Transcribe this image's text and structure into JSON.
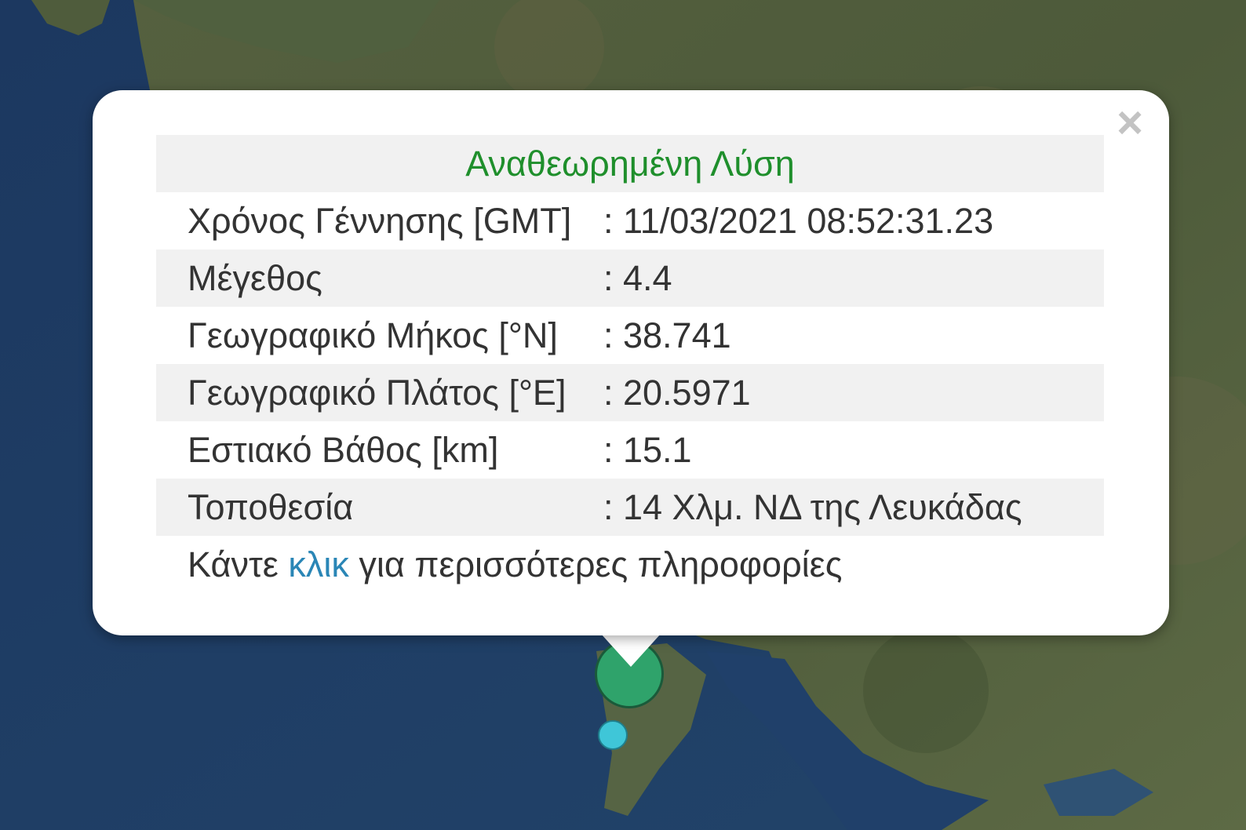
{
  "popup": {
    "title": "Αναθεωρημένη Λύση",
    "close_label": "×",
    "rows": [
      {
        "label": "Χρόνος Γέννησης [GMT]",
        "value": ": 11/03/2021 08:52:31.23"
      },
      {
        "label": "Μέγεθος",
        "value": ": 4.4"
      },
      {
        "label": "Γεωγραφικό Μήκος [°N]",
        "value": ": 38.741"
      },
      {
        "label": "Γεωγραφικό Πλάτος [°E]",
        "value": ": 20.5971"
      },
      {
        "label": "Εστιακό Βάθος [km]",
        "value": ": 15.1"
      },
      {
        "label": "Τοποθεσία",
        "value": ": 14 Χλμ. ΝΔ της Λευκάδας"
      }
    ],
    "more_prefix": "Κάντε ",
    "more_link": "κλικ",
    "more_suffix": " για περισσότερες πληροφορίες",
    "title_color": "#1f8f2c",
    "link_color": "#2a86b6"
  },
  "markers": [
    {
      "name": "earthquake-marker-large",
      "color": "#2fa36b"
    },
    {
      "name": "earthquake-marker-small",
      "color": "#3fc6d8"
    }
  ],
  "map": {
    "sea_color": "#1d3a5e",
    "land_color": "#4a5a3a"
  }
}
